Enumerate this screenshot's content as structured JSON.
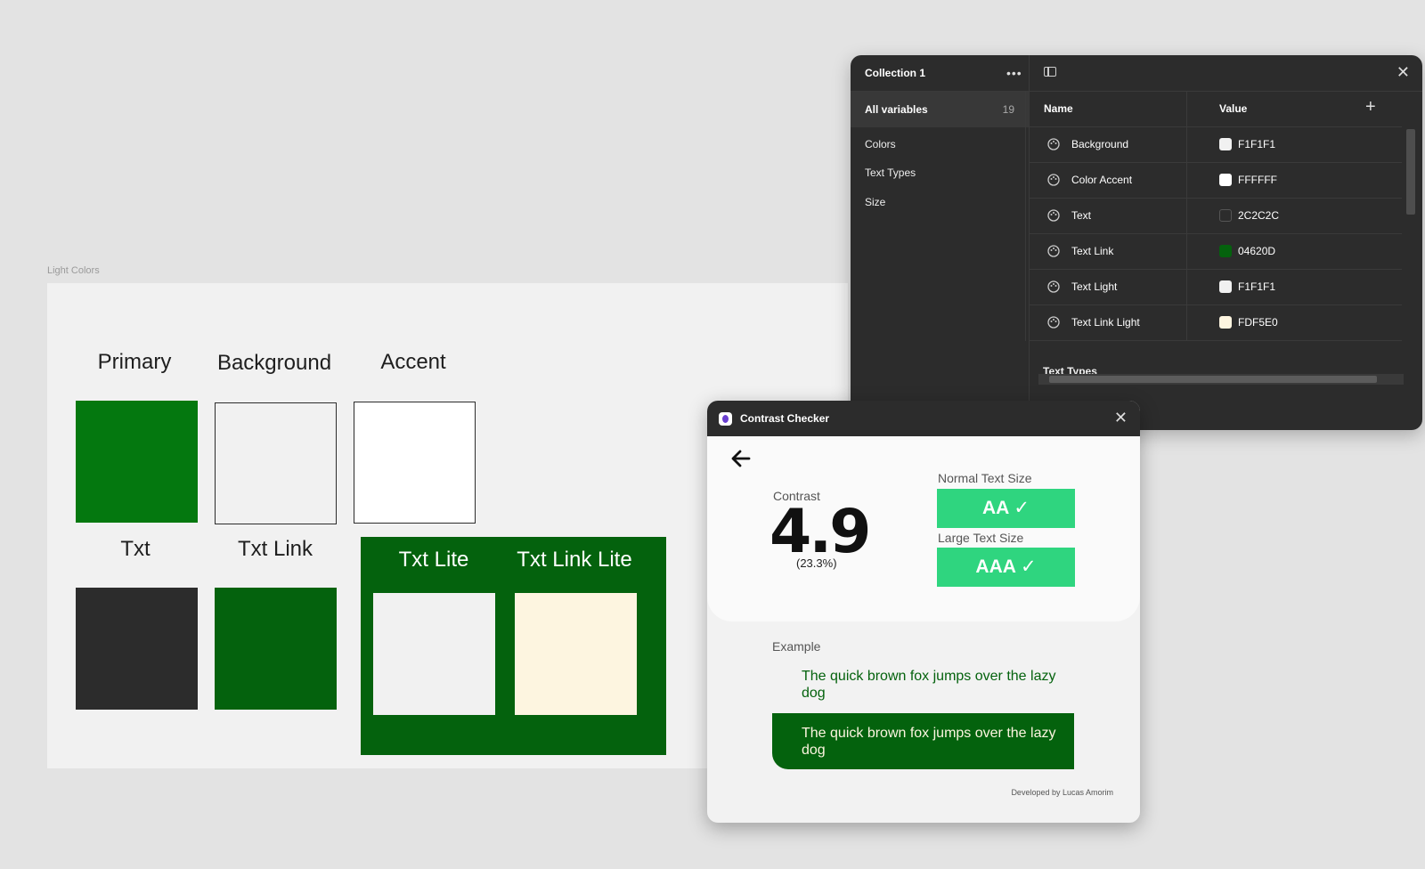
{
  "frame": {
    "label": "Light Colors",
    "swatches": [
      {
        "label": "Primary",
        "color": "#04780f"
      },
      {
        "label": "Background",
        "color": "#f1f1f1"
      },
      {
        "label": "Accent",
        "color": "#ffffff"
      },
      {
        "label": "Txt",
        "color": "#2c2c2c"
      },
      {
        "label": "Txt Link",
        "color": "#04620d"
      },
      {
        "label": "Txt Lite",
        "color": "#f1f1f1"
      },
      {
        "label": "Txt Link Lite",
        "color": "#fdf5e0"
      }
    ]
  },
  "variables_panel": {
    "collection_title": "Collection 1",
    "all_variables_label": "All variables",
    "all_variables_count": "19",
    "groups": [
      "Colors",
      "Text Types",
      "Size"
    ],
    "column_name": "Name",
    "column_value": "Value",
    "rows": [
      {
        "name": "Background",
        "value": "F1F1F1",
        "color": "#f1f1f1"
      },
      {
        "name": "Color Accent",
        "value": "FFFFFF",
        "color": "#ffffff"
      },
      {
        "name": "Text",
        "value": "2C2C2C",
        "color": "#2c2c2c"
      },
      {
        "name": "Text Link",
        "value": "04620D",
        "color": "#04620d"
      },
      {
        "name": "Text Light",
        "value": "F1F1F1",
        "color": "#f1f1f1"
      },
      {
        "name": "Text Link Light",
        "value": "FDF5E0",
        "color": "#fdf5e0"
      }
    ],
    "next_section": "Text Types"
  },
  "contrast_checker": {
    "title": "Contrast Checker",
    "contrast_label": "Contrast",
    "contrast_value": "4.9",
    "contrast_percent": "(23.3%)",
    "normal_label": "Normal Text Size",
    "normal_result": "AA ✓",
    "large_label": "Large Text Size",
    "large_result": "AAA ✓",
    "example_label": "Example",
    "example_text": "The quick brown fox jumps over the lazy dog",
    "credit": "Developed by Lucas Amorim",
    "badge_color": "#2fd57f"
  }
}
